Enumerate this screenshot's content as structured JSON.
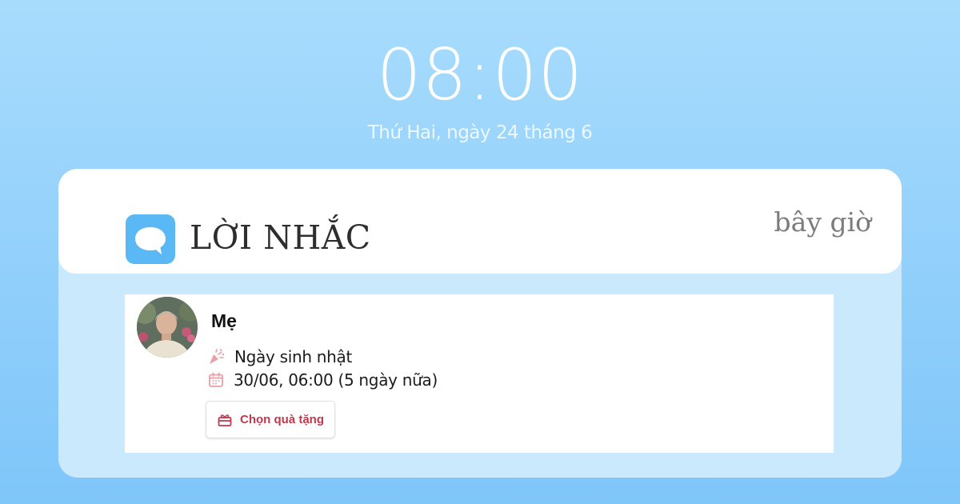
{
  "lockscreen": {
    "time": "08:00",
    "date": "Thứ Hai, ngày 24 tháng 6"
  },
  "notification": {
    "app_name": "LỜI NHẮC",
    "app_icon": "chat-bubble-icon",
    "timestamp": "bây giờ",
    "reminder": {
      "contact_name": "Mẹ",
      "occasion_icon": "party-popper-icon",
      "occasion": "Ngày sinh nhật",
      "date_icon": "calendar-icon",
      "datetime": "30/06, 06:00 (5 ngày nữa)",
      "gift_icon": "gift-icon",
      "gift_button_label": "Chọn quà tặng"
    }
  },
  "colors": {
    "accent": "#5ab8f5",
    "button_text": "#c0394b",
    "background": "#a8dcfd"
  }
}
